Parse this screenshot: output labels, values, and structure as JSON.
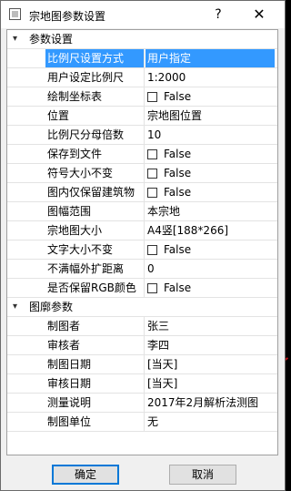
{
  "window": {
    "title": "宗地图参数设置",
    "help_label": "?",
    "close_label": "✕"
  },
  "categories": [
    {
      "label": "参数设置",
      "rows": [
        {
          "name": "比例尺设置方式",
          "value": "用户指定",
          "selected": true
        },
        {
          "name": "用户设定比例尺",
          "value": "1:2000"
        },
        {
          "name": "绘制坐标表",
          "value": "False",
          "checkbox": true
        },
        {
          "name": "位置",
          "value": "宗地图位置"
        },
        {
          "name": "比例尺分母倍数",
          "value": "10"
        },
        {
          "name": "保存到文件",
          "value": "False",
          "checkbox": true
        },
        {
          "name": "符号大小不变",
          "value": "False",
          "checkbox": true
        },
        {
          "name": "图内仅保留建筑物",
          "value": "False",
          "checkbox": true
        },
        {
          "name": "图幅范围",
          "value": "本宗地"
        },
        {
          "name": "宗地图大小",
          "value": "A4竖[188*266]"
        },
        {
          "name": "文字大小不变",
          "value": "False",
          "checkbox": true
        },
        {
          "name": "不满幅外扩距离",
          "value": "0"
        },
        {
          "name": "是否保留RGB颜色",
          "value": "False",
          "checkbox": true
        }
      ]
    },
    {
      "label": "图廓参数",
      "rows": [
        {
          "name": "制图者",
          "value": "张三"
        },
        {
          "name": "审核者",
          "value": "李四"
        },
        {
          "name": "制图日期",
          "value": "[当天]"
        },
        {
          "name": "审核日期",
          "value": "[当天]"
        },
        {
          "name": "测量说明",
          "value": "2017年2月解析法测图"
        },
        {
          "name": "制图单位",
          "value": "无"
        }
      ]
    }
  ],
  "buttons": {
    "ok_label": "确定",
    "cancel_label": "取消"
  },
  "colors": {
    "selection": "#3399ff",
    "default_button_border": "#0078d7"
  }
}
